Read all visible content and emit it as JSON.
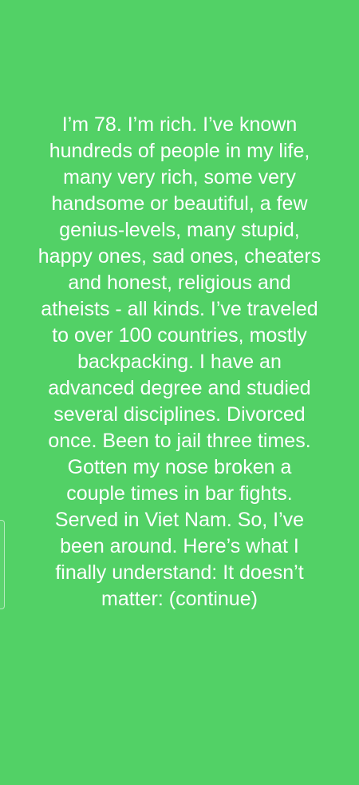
{
  "background_color": "#52d166",
  "text_color": "#ffffff",
  "story": {
    "lines": [
      "I’m 78. I’m rich. I’ve known",
      "hundreds of people in my life,",
      "many very rich, some very",
      "handsome or beautiful, a few",
      "genius-levels, many stupid,",
      "happy ones, sad ones, cheaters",
      "and honest, religious and",
      "atheists - all kinds. I’ve traveled",
      "to over 100 countries, mostly",
      "backpacking. I have an",
      "advanced degree and studied",
      "several disciplines. Divorced",
      "once. Been to jail three times.",
      "Gotten my nose broken a",
      "couple times in bar fights.",
      "Served in Viet Nam. So, I’ve",
      "been around. Here’s what I",
      "finally understand: It doesn’t",
      "matter: (continue)"
    ]
  }
}
